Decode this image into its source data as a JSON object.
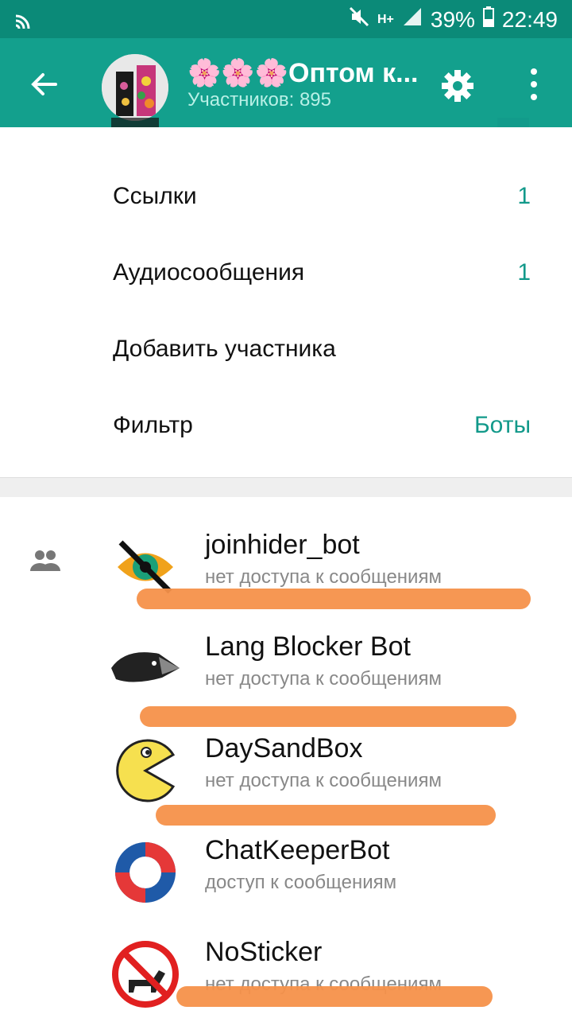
{
  "status": {
    "signal": "H+",
    "battery": "39%",
    "time": "22:49"
  },
  "header": {
    "title": "🌸🌸🌸Оптом к...",
    "subtitle": "Участников: 895"
  },
  "rows": [
    {
      "label": "Ссылки",
      "value": "1"
    },
    {
      "label": "Аудиосообщения",
      "value": "1"
    },
    {
      "label": "Добавить участника",
      "value": ""
    },
    {
      "label": "Фильтр",
      "value": "Боты"
    }
  ],
  "members": [
    {
      "name": "joinhider_bot",
      "sub": "нет доступа к сообщениям"
    },
    {
      "name": "Lang Blocker Bot",
      "sub": "нет доступа к сообщениям"
    },
    {
      "name": "DaySandBox",
      "sub": "нет доступа к сообщениям"
    },
    {
      "name": "ChatKeeperBot",
      "sub": "доступ к сообщениям"
    },
    {
      "name": "NoSticker",
      "sub": "нет доступа к сообщениям"
    }
  ],
  "colors": {
    "appbar": "#13a08d",
    "statusbar": "#0b8a78",
    "accent": "#12998a",
    "highlight": "#f5914a"
  },
  "icons": [
    "cast-icon",
    "mute-icon",
    "signal-icon",
    "battery-icon",
    "back-arrow-icon",
    "settings-gear-icon",
    "more-vert-icon",
    "group-icon"
  ]
}
